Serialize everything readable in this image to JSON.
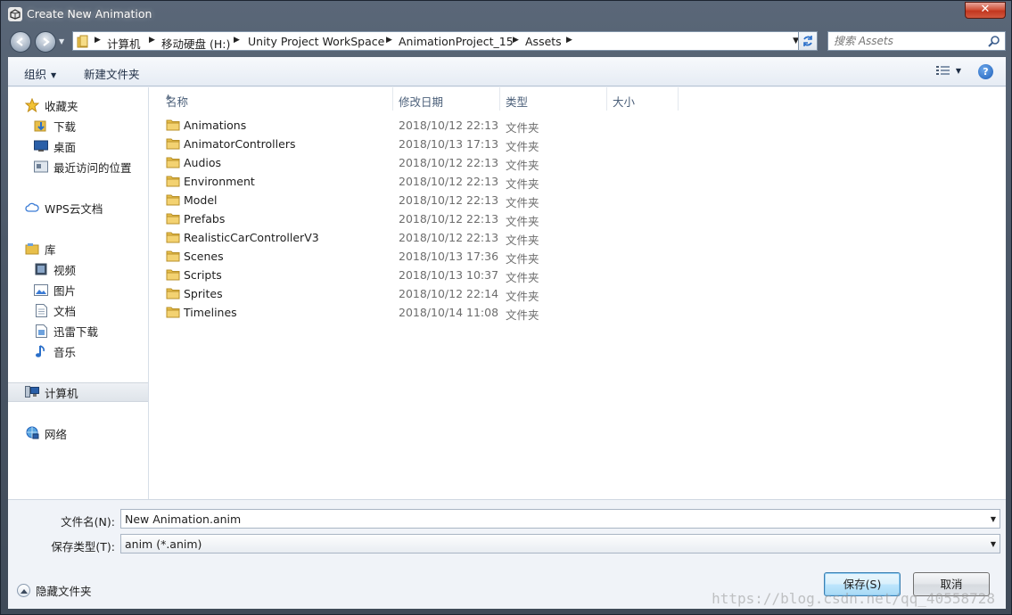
{
  "window": {
    "title": "Create New Animation",
    "close_label": "✕"
  },
  "address": {
    "crumbs": [
      "计算机",
      "移动硬盘 (H:)",
      "Unity Project WorkSpace",
      "AnimationProject_15",
      "Assets"
    ]
  },
  "search": {
    "placeholder": "搜索 Assets"
  },
  "toolbar": {
    "organize": "组织",
    "new_folder": "新建文件夹",
    "help": "?"
  },
  "sidebar": {
    "favorites": {
      "label": "收藏夹",
      "items": [
        "下载",
        "桌面",
        "最近访问的位置"
      ]
    },
    "wps": "WPS云文档",
    "libraries": {
      "label": "库",
      "items": [
        "视频",
        "图片",
        "文档",
        "迅雷下载",
        "音乐"
      ]
    },
    "computer": "计算机",
    "network": "网络"
  },
  "columns": {
    "name": "名称",
    "date": "修改日期",
    "type": "类型",
    "size": "大小"
  },
  "files": [
    {
      "name": "Animations",
      "date": "2018/10/12 22:13",
      "type": "文件夹"
    },
    {
      "name": "AnimatorControllers",
      "date": "2018/10/13 17:13",
      "type": "文件夹"
    },
    {
      "name": "Audios",
      "date": "2018/10/12 22:13",
      "type": "文件夹"
    },
    {
      "name": "Environment",
      "date": "2018/10/12 22:13",
      "type": "文件夹"
    },
    {
      "name": "Model",
      "date": "2018/10/12 22:13",
      "type": "文件夹"
    },
    {
      "name": "Prefabs",
      "date": "2018/10/12 22:13",
      "type": "文件夹"
    },
    {
      "name": "RealisticCarControllerV3",
      "date": "2018/10/12 22:13",
      "type": "文件夹"
    },
    {
      "name": "Scenes",
      "date": "2018/10/13 17:36",
      "type": "文件夹"
    },
    {
      "name": "Scripts",
      "date": "2018/10/13 10:37",
      "type": "文件夹"
    },
    {
      "name": "Sprites",
      "date": "2018/10/12 22:14",
      "type": "文件夹"
    },
    {
      "name": "Timelines",
      "date": "2018/10/14 11:08",
      "type": "文件夹"
    }
  ],
  "form": {
    "filename_label": "文件名(N):",
    "filename_value": "New Animation.anim",
    "filetype_label": "保存类型(T):",
    "filetype_value": "anim (*.anim)"
  },
  "buttons": {
    "save": "保存(S)",
    "cancel": "取消",
    "hide_folders": "隐藏文件夹"
  },
  "watermark": "https://blog.csdn.net/qq_40558728",
  "colors": {
    "folder": "#e8bf4a",
    "accent": "#1d5fb9"
  }
}
